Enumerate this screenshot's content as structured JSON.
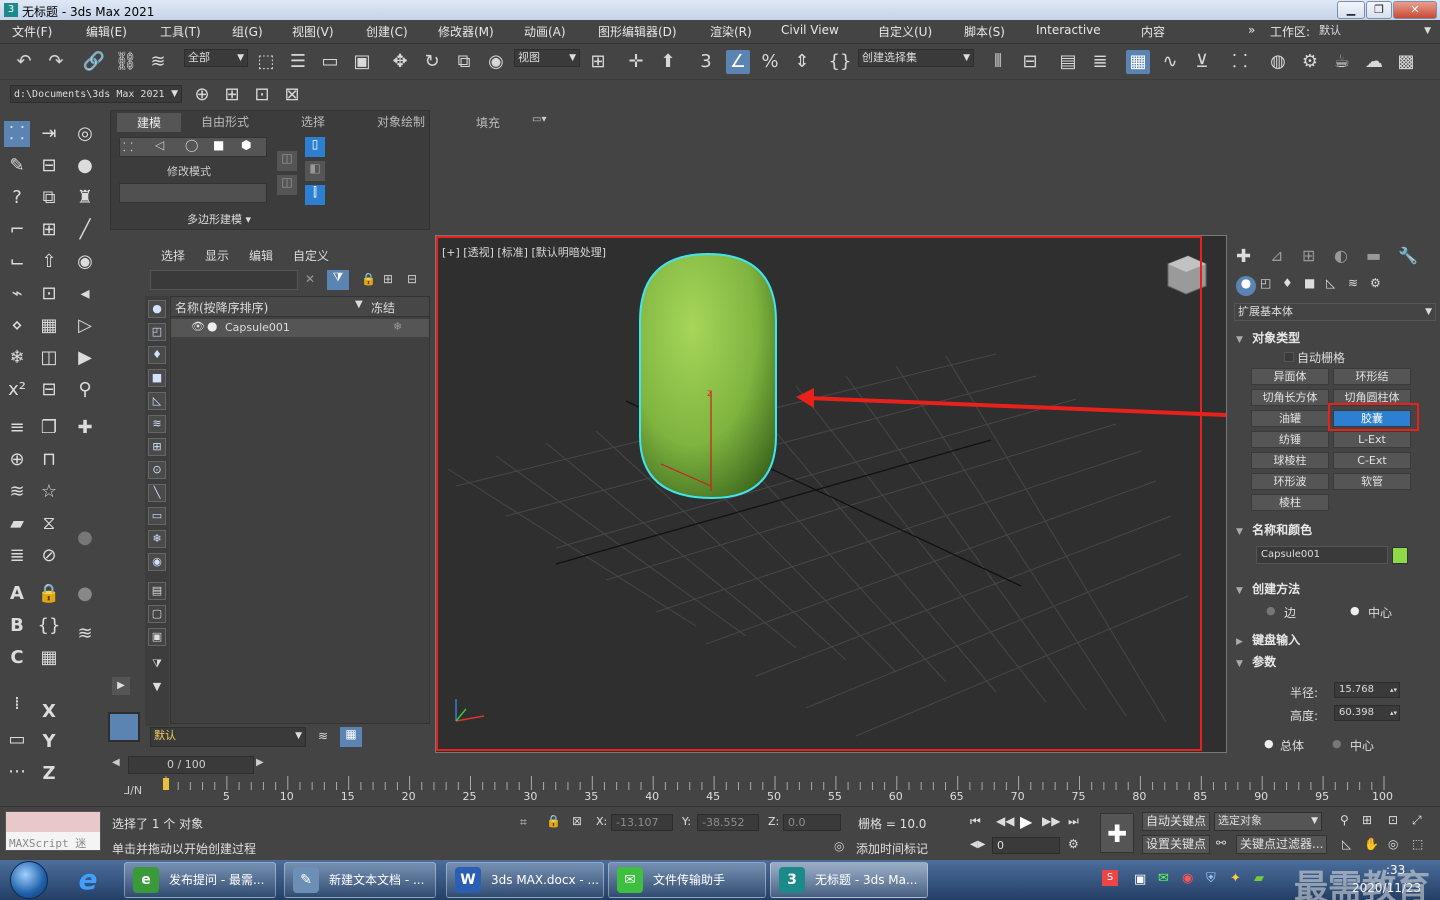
{
  "window": {
    "title": "无标题 - 3ds Max 2021",
    "min": "▁",
    "max": "❐",
    "close": "✕",
    "logo": "3"
  },
  "menu": [
    "文件(F)",
    "编辑(E)",
    "工具(T)",
    "组(G)",
    "视图(V)",
    "创建(C)",
    "修改器(M)",
    "动画(A)",
    "图形编辑器(D)",
    "渲染(R)",
    "Civil View",
    "自定义(U)",
    "脚本(S)",
    "Interactive",
    "内容"
  ],
  "workspace": {
    "label": "工作区:",
    "value": "默认",
    "more": "»"
  },
  "toolbar": {
    "selection_filter": "全部",
    "ref_coord": "视图",
    "named_selection": "创建选择集",
    "project_path": "d:\\Documents\\3ds Max 2021"
  },
  "ribbon": {
    "tabs": [
      "建模",
      "自由形式",
      "选择",
      "对象绘制",
      "填充"
    ],
    "modify_mode": "修改模式",
    "poly_modeling": "多边形建模 ▾"
  },
  "explorer": {
    "tabs": [
      "选择",
      "显示",
      "编辑",
      "自定义"
    ],
    "col_name": "名称(按降序排序)",
    "col_freeze": "冻结",
    "rows": [
      {
        "name": "Capsule001",
        "freeze": "❄"
      }
    ],
    "layer_default": "默认"
  },
  "viewport": {
    "label": "[+] [透视] [标准] [默认明暗处理]",
    "object_color": "#8dbf4a",
    "selection_color": "#3ee6f0",
    "annotation_color": "#e8211c",
    "axis_z": "z"
  },
  "command_panel": {
    "category": "扩展基本体",
    "object_type": {
      "title": "对象类型",
      "autogrid": "自动栅格",
      "buttons": [
        "异面体",
        "环形结",
        "切角长方体",
        "切角圆柱体",
        "油罐",
        "胶囊",
        "纺锤",
        "L-Ext",
        "球棱柱",
        "C-Ext",
        "环形波",
        "软管",
        "棱柱"
      ],
      "selected": "胶囊"
    },
    "name_color": {
      "title": "名称和颜色",
      "name": "Capsule001",
      "swatch": "#8dd94a"
    },
    "creation_method": {
      "title": "创建方法",
      "options": [
        "边",
        "中心"
      ],
      "selected": "中心"
    },
    "keyboard_entry": {
      "title": "键盘输入"
    },
    "parameters": {
      "title": "参数",
      "radius_label": "半径:",
      "radius": "15.768",
      "height_label": "高度:",
      "height": "60.398",
      "options": [
        "总体",
        "中心"
      ],
      "selected": "总体"
    }
  },
  "timeline": {
    "frame": "0 / 100",
    "ticks": [
      "5",
      "10",
      "15",
      "20",
      "25",
      "30",
      "35",
      "40",
      "45",
      "50",
      "55",
      "60",
      "65",
      "70",
      "75",
      "80",
      "85",
      "90",
      "95",
      "100"
    ],
    "mini_label": "⅃∕N"
  },
  "status": {
    "maxscript": "MAXScript 迷",
    "selected": "选择了 1 个 对象",
    "prompt": "单击并拖动以开始创建过程",
    "x_label": "X:",
    "x": "-13.107",
    "y_label": "Y:",
    "y": "-38.552",
    "z_label": "Z:",
    "z": "0.0",
    "grid": "栅格 = 10.0",
    "add_time_tag": "添加时间标记",
    "auto_key": "自动关键点",
    "set_key": "设置关键点",
    "selected_obj": "选定对象",
    "key_filter": "关键点过滤器...",
    "frame_spin": "0"
  },
  "taskbar": {
    "tasks": [
      {
        "label": "发布提问 - 最需...",
        "icon_color": "#3a9a3a",
        "icon_glyph": "e"
      },
      {
        "label": "新建文本文档 - ...",
        "icon_color": "#6d8fb5",
        "icon_glyph": "✎"
      },
      {
        "label": "3ds MAX.docx - ...",
        "icon_color": "#2b5fb4",
        "icon_glyph": "W"
      },
      {
        "label": "文件传输助手",
        "icon_color": "#3fbf3f",
        "icon_glyph": "✉"
      },
      {
        "label": "无标题 - 3ds Ma...",
        "icon_color": "#1c8a8a",
        "icon_glyph": "3"
      }
    ],
    "clock_time": ":33",
    "clock_date": "2020/11/23",
    "watermark": "最需教育"
  }
}
